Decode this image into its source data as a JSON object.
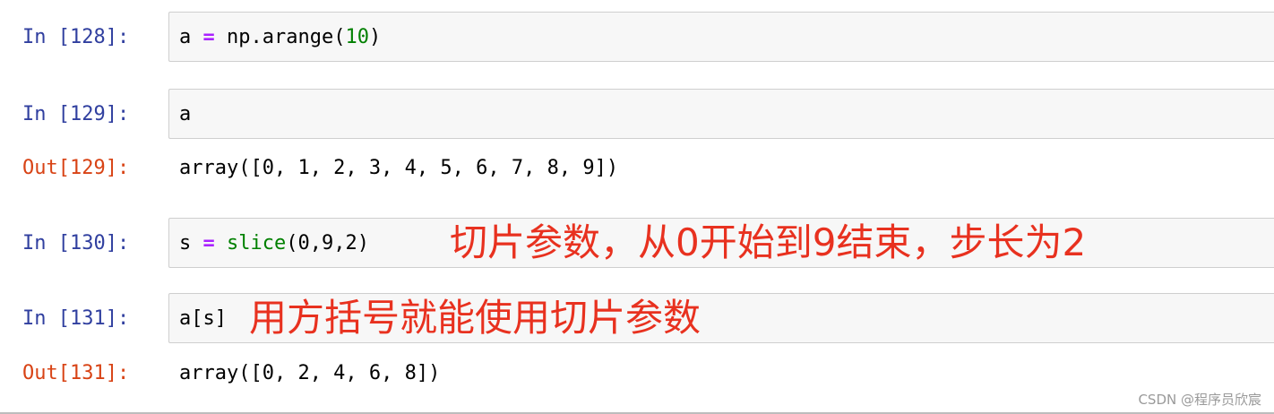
{
  "cells": [
    {
      "in_prompt": "In [128]:",
      "code": {
        "var": "a",
        "op": "=",
        "call": "np.arange(",
        "arg": "10",
        "close": ")"
      }
    },
    {
      "in_prompt": "In [129]:",
      "code_text": "a",
      "out_prompt": "Out[129]:",
      "output": "array([0, 1, 2, 3, 4, 5, 6, 7, 8, 9])"
    },
    {
      "in_prompt": "In [130]:",
      "code": {
        "var": "s",
        "op": "=",
        "call": "slice",
        "args": "(0,9,2)"
      },
      "annotation": "切片参数，从0开始到9结束，步长为2"
    },
    {
      "in_prompt": "In [131]:",
      "code_text": "a[s]",
      "annotation": "用方括号就能使用切片参数",
      "out_prompt": "Out[131]:",
      "output": "array([0, 2, 4, 6, 8])"
    }
  ],
  "watermark": "CSDN @程序员欣宸",
  "colors": {
    "in_prompt": "#303f9f",
    "out_prompt": "#d84315",
    "annotation": "#e8311f",
    "operator": "#aa22ff",
    "number": "#008000"
  }
}
